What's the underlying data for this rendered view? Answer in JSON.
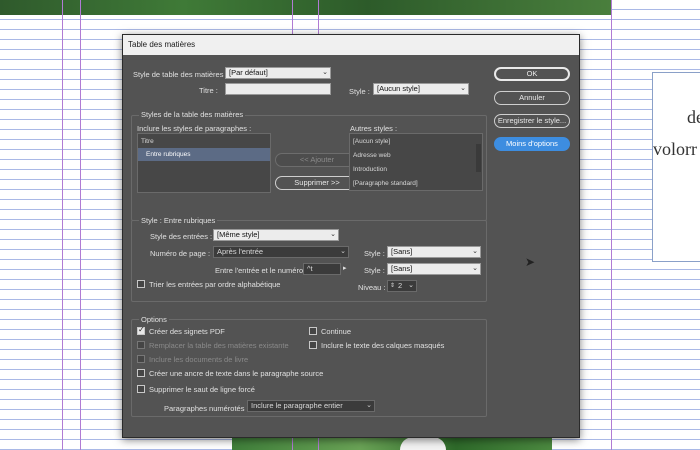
{
  "dialog": {
    "title": "Table des matières",
    "toc_style_label": "Style de table des matières :",
    "toc_style_value": "[Par défaut]",
    "title_label": "Titre :",
    "title_value": "",
    "title_style_label": "Style :",
    "title_style_value": "[Aucun style]"
  },
  "buttons": {
    "ok": "OK",
    "cancel": "Annuler",
    "save_style": "Enregistrer le style...",
    "fewer_options": "Moins d'options",
    "add": "<< Ajouter",
    "remove": "Supprimer >>"
  },
  "styles_section": {
    "legend": "Styles de la table des matières",
    "include_label": "Inclure les styles de paragraphes :",
    "included": [
      "Titre",
      "Entre rubriques"
    ],
    "other_label": "Autres styles :",
    "others": [
      "[Aucun style]",
      "Adresse web",
      "Introduction",
      "[Paragraphe standard]"
    ]
  },
  "entry_section": {
    "legend": "Style : Entre rubriques",
    "entry_style_label": "Style des entrées :",
    "entry_style_value": "[Même style]",
    "page_number_label": "Numéro de page :",
    "page_number_value": "Après l'entrée",
    "page_style_label": "Style :",
    "page_style_value": "[Sans]",
    "between_label": "Entre l'entrée et le numéro :",
    "between_value": "^t",
    "between_style_label": "Style :",
    "between_style_value": "[Sans]",
    "sort_label": "Trier les entrées par ordre alphabétique",
    "level_label": "Niveau :",
    "level_value": "2"
  },
  "options_section": {
    "legend": "Options",
    "create_bookmarks": "Créer des signets PDF",
    "replace_toc": "Remplacer la table des matières existante",
    "include_book": "Inclure les documents de livre",
    "create_anchor": "Créer une ancre de texte dans le paragraphe source",
    "remove_break": "Supprimer le saut de ligne forcé",
    "run_in": "Continue",
    "hidden_layers": "Inclure le texte des calques masqués",
    "numbered_label": "Paragraphes numérotés :",
    "numbered_value": "Inclure le paragraphe entier"
  },
  "background": {
    "text_line1": "de",
    "text_line2": "volorr"
  }
}
